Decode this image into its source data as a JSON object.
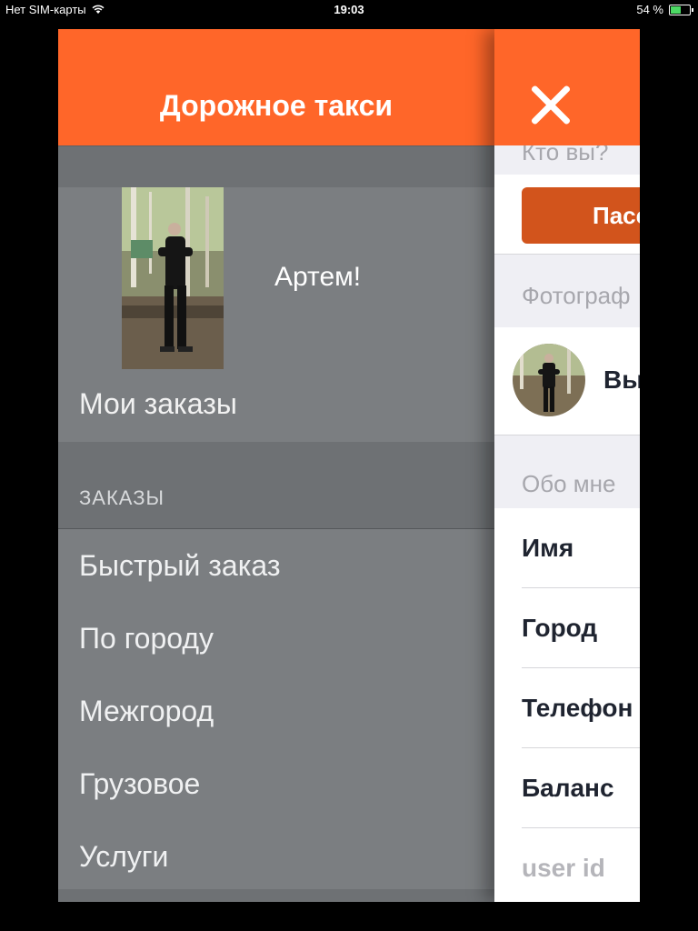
{
  "status_bar": {
    "carrier": "Нет SIM-карты",
    "time": "19:03",
    "battery": "54 %",
    "battery_level": 0.54
  },
  "drawer": {
    "title": "Дорожное такси",
    "user_name": "Артем!",
    "my_orders": "Мои заказы",
    "section_title": "ЗАКАЗЫ",
    "items": [
      {
        "label": "Быстрый заказ"
      },
      {
        "label": "По городу"
      },
      {
        "label": "Межгород"
      },
      {
        "label": "Грузовое"
      },
      {
        "label": "Услуги"
      }
    ]
  },
  "panel": {
    "who_label": "Кто вы?",
    "role_button": "Пасс",
    "photo_label": "Фотограф",
    "photo_action": "Вы",
    "about_label": "Обо мне",
    "fields": {
      "name": "Имя",
      "city": "Город",
      "phone": "Телефон",
      "balance": "Баланс",
      "user_id": "user id"
    }
  },
  "colors": {
    "accent": "#ff6629",
    "button": "#d2541c",
    "drawer_bg": "#7b7e81"
  }
}
